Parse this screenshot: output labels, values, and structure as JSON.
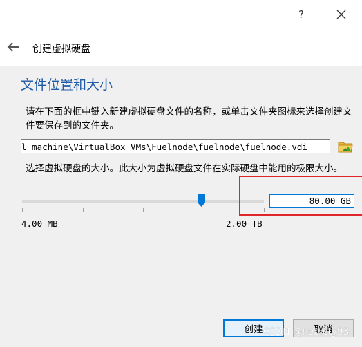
{
  "titlebar": {
    "help_label": "?"
  },
  "header": {
    "title": "创建虚拟硬盘"
  },
  "section": {
    "title": "文件位置和大小"
  },
  "location": {
    "description": "请在下面的框中键入新建虚拟硬盘文件的名称，或单击文件夹图标来选择创建文件要保存到的文件夹。",
    "path_value": "l machine\\VirtualBox VMs\\Fuelnode\\fuelnode\\fuelnode.vdi"
  },
  "size": {
    "description": "选择虚拟硬盘的大小。此大小为虚拟硬盘文件在实际硬盘中能用的极限大小。",
    "value": "80.00 GB",
    "min_label": "4.00 MB",
    "max_label": "2.00 TB",
    "slider_fraction": 0.74
  },
  "buttons": {
    "create": "创建",
    "cancel": "取消"
  },
  "watermark": "CSDN @hebiety93",
  "colors": {
    "title_blue": "#1f5aa8",
    "highlight_red": "#e0262a",
    "focus_blue": "#0078d7"
  }
}
